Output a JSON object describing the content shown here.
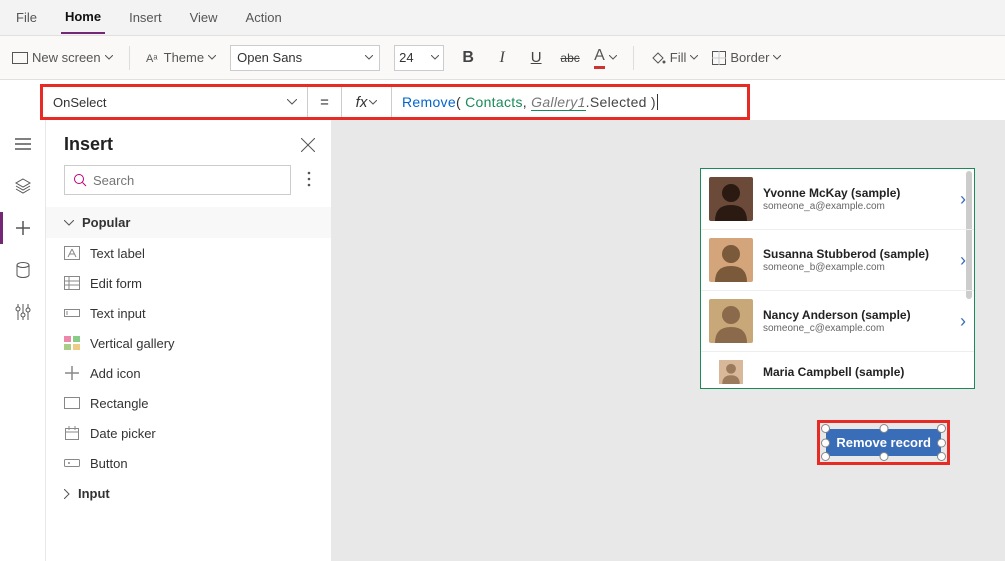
{
  "menu": {
    "file": "File",
    "home": "Home",
    "insert": "Insert",
    "view": "View",
    "action": "Action"
  },
  "toolbar": {
    "new_screen": "New screen",
    "theme": "Theme",
    "font": "Open Sans",
    "size": "24",
    "fill": "Fill",
    "border": "Border"
  },
  "formula": {
    "property": "OnSelect",
    "fx": "fx",
    "fn": "Remove",
    "open": "( ",
    "datasource": "Contacts",
    "comma": ", ",
    "gallery": "Gallery1",
    "selected": ".Selected )"
  },
  "panel": {
    "title": "Insert",
    "search_placeholder": "Search",
    "categories": {
      "popular": "Popular",
      "input": "Input"
    },
    "items": {
      "text_label": "Text label",
      "edit_form": "Edit form",
      "text_input": "Text input",
      "vertical_gallery": "Vertical gallery",
      "add_icon": "Add icon",
      "rectangle": "Rectangle",
      "date_picker": "Date picker",
      "button": "Button"
    }
  },
  "gallery": [
    {
      "name": "Yvonne McKay (sample)",
      "email": "someone_a@example.com",
      "avatar_bg": "#6b4a3a",
      "avatar_fg": "#2a1a12"
    },
    {
      "name": "Susanna Stubberod (sample)",
      "email": "someone_b@example.com",
      "avatar_bg": "#d4a57a",
      "avatar_fg": "#7a5a3a"
    },
    {
      "name": "Nancy Anderson (sample)",
      "email": "someone_c@example.com",
      "avatar_bg": "#c8a878",
      "avatar_fg": "#8a6a4a"
    },
    {
      "name": "Maria Campbell (sample)",
      "email": "",
      "avatar_bg": "#d8b898",
      "avatar_fg": "#9a7a5a"
    }
  ],
  "button": {
    "label": "Remove record"
  }
}
